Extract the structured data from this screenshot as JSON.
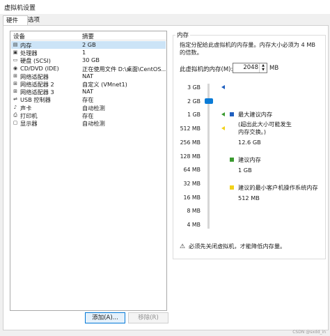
{
  "window": {
    "title": "虚拟机设置"
  },
  "tabs": [
    {
      "label": "硬件"
    },
    {
      "label": "选项"
    }
  ],
  "device_table": {
    "headers": [
      "设备",
      "摘要"
    ],
    "rows": [
      {
        "icon": "memory-icon",
        "device": "内存",
        "summary": "2 GB",
        "selected": true
      },
      {
        "icon": "cpu-icon",
        "device": "处理器",
        "summary": "1"
      },
      {
        "icon": "disk-icon",
        "device": "硬盘 (SCSI)",
        "summary": "30 GB"
      },
      {
        "icon": "cdrom-icon",
        "device": "CD/DVD (IDE)",
        "summary": "正在使用文件 D:\\桌面\\CentOS..."
      },
      {
        "icon": "network-icon",
        "device": "网络适配器",
        "summary": "NAT"
      },
      {
        "icon": "network-icon",
        "device": "网络适配器 2",
        "summary": "自定义 (VMnet1)"
      },
      {
        "icon": "network-icon",
        "device": "网络适配器 3",
        "summary": "NAT"
      },
      {
        "icon": "usb-icon",
        "device": "USB 控制器",
        "summary": "存在"
      },
      {
        "icon": "sound-icon",
        "device": "声卡",
        "summary": "自动检测"
      },
      {
        "icon": "printer-icon",
        "device": "打印机",
        "summary": "存在"
      },
      {
        "icon": "display-icon",
        "device": "显示器",
        "summary": "自动检测"
      }
    ]
  },
  "buttons": {
    "add": "添加(A)...",
    "remove": "移除(R)"
  },
  "memory": {
    "group_title": "内存",
    "description": "指定分配给此虚拟机的内存量。内存大小必须为 4 MB 的倍数。",
    "field_label": "此虚拟机的内存(M):",
    "value": "2048",
    "unit": "MB",
    "scale_labels": [
      "3 GB",
      "2 GB",
      "1 GB",
      "512 MB",
      "256 MB",
      "128 MB",
      "64 MB",
      "32 MB",
      "16 MB",
      "8 MB",
      "4 MB"
    ],
    "legend": {
      "max_title": "最大建议内存",
      "max_note": "(超出此大小可能发生内存交换。)",
      "max_value": "12.6 GB",
      "rec_title": "建议内存",
      "rec_value": "1 GB",
      "min_title": "建议的最小客户机操作系统内存",
      "min_value": "512 MB"
    },
    "colors": {
      "max": "#1f5fbf",
      "rec": "#3a9a2f",
      "min": "#f2d21b",
      "slider": "#0a7bd6"
    },
    "warning": "必须先关闭虚拟机，才能降低内存量。"
  },
  "watermark": "CSDN @sxdd_in"
}
